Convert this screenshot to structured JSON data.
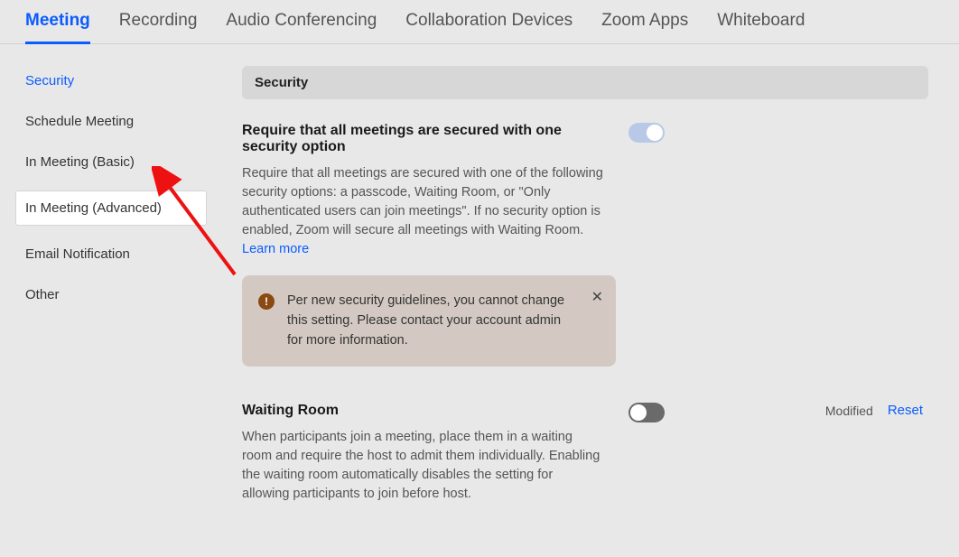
{
  "tabs": [
    "Meeting",
    "Recording",
    "Audio Conferencing",
    "Collaboration Devices",
    "Zoom Apps",
    "Whiteboard"
  ],
  "sidebar": {
    "items": [
      "Security",
      "Schedule Meeting",
      "In Meeting (Basic)",
      "In Meeting (Advanced)",
      "Email Notification",
      "Other"
    ]
  },
  "section": {
    "header": "Security"
  },
  "setting1": {
    "title": "Require that all meetings are secured with one security option",
    "desc": "Require that all meetings are secured with one of the following security options: a passcode, Waiting Room, or \"Only authenticated users can join meetings\". If no security option is enabled, Zoom will secure all meetings with Waiting Room. ",
    "learn_more": "Learn more",
    "toggle_state": "on-locked"
  },
  "info": {
    "text": "Per new security guidelines, you cannot change this setting. Please contact your account admin for more information.",
    "icon_glyph": "!"
  },
  "setting2": {
    "title": "Waiting Room",
    "desc": "When participants join a meeting, place them in a waiting room and require the host to admit them individually. Enabling the waiting room automatically disables the setting for allowing participants to join before host.",
    "toggle_state": "off",
    "modified_label": "Modified",
    "reset_label": "Reset"
  }
}
